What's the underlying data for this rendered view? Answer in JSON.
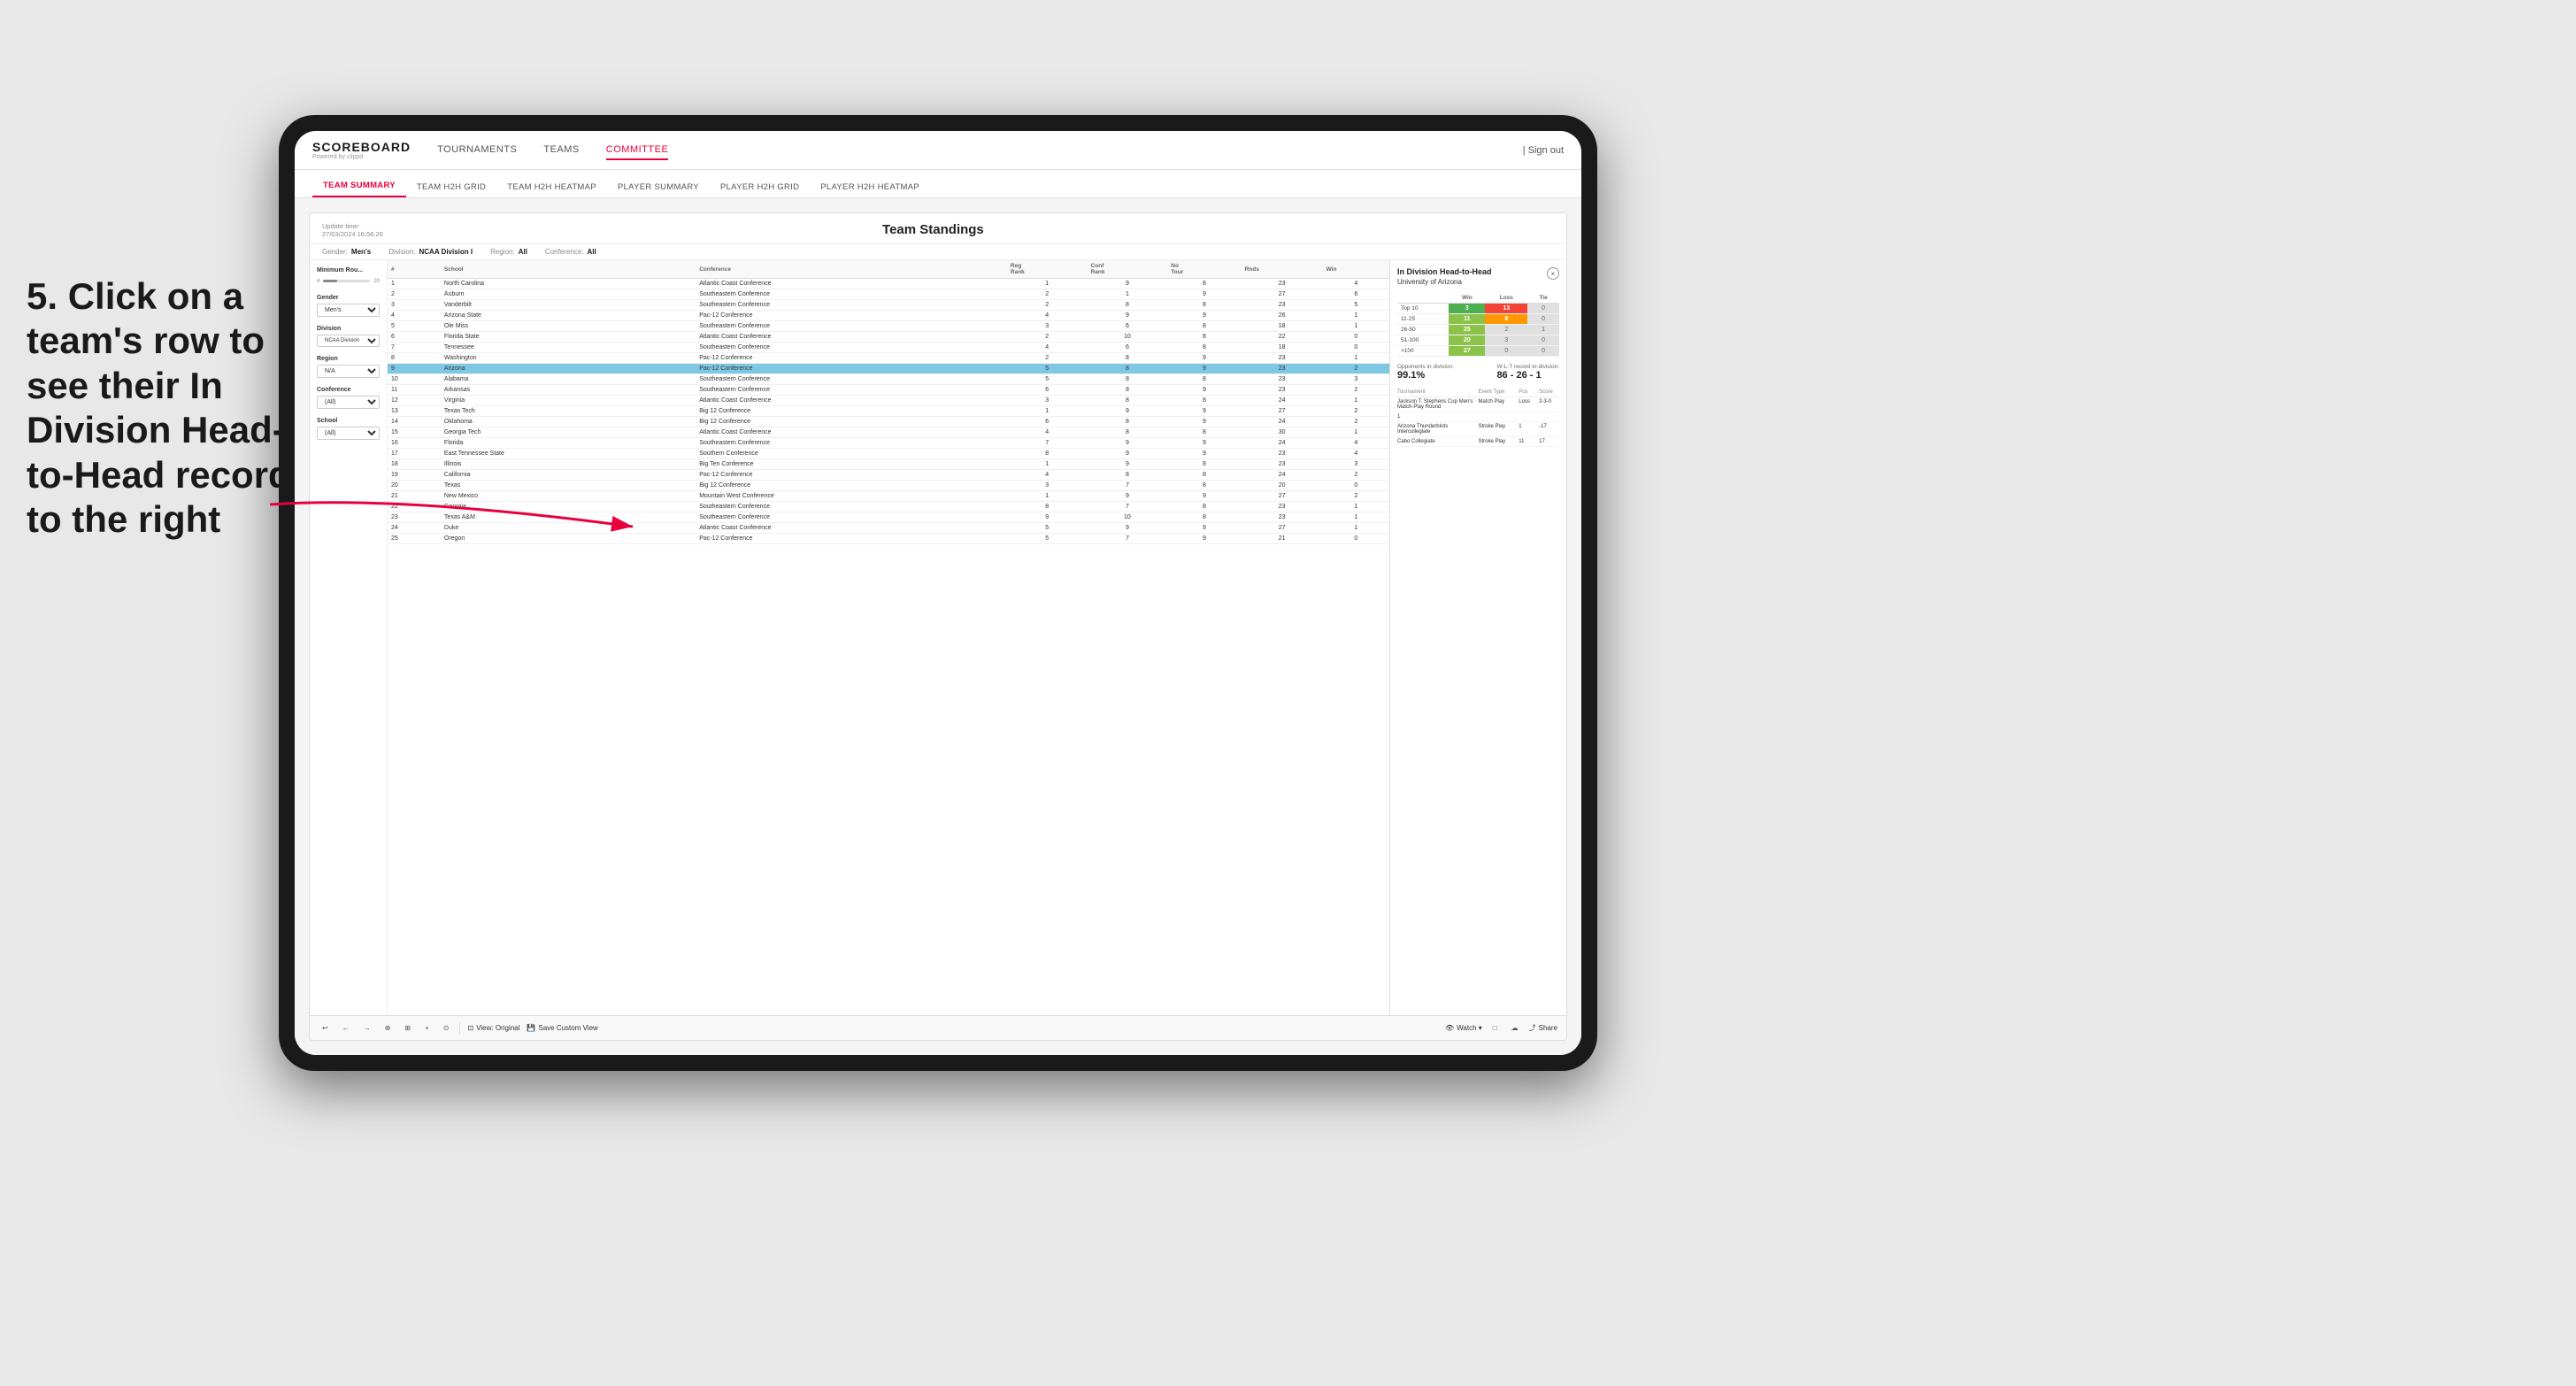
{
  "background_color": "#e8e8e8",
  "annotation": {
    "text": "5. Click on a team's row to see their In Division Head-to-Head record to the right"
  },
  "top_nav": {
    "logo": "SCOREBOARD",
    "logo_sub": "Powered by clippd",
    "items": [
      "TOURNAMENTS",
      "TEAMS",
      "COMMITTEE"
    ],
    "active_item": "COMMITTEE",
    "sign_out": "Sign out"
  },
  "secondary_nav": {
    "items": [
      "TEAM SUMMARY",
      "TEAM H2H GRID",
      "TEAM H2H HEATMAP",
      "PLAYER SUMMARY",
      "PLAYER H2H GRID",
      "PLAYER H2H HEATMAP"
    ],
    "active_item": "TEAM SUMMARY"
  },
  "panel": {
    "update_time_label": "Update time:",
    "update_time_value": "27/03/2024 16:56:26",
    "title": "Team Standings"
  },
  "filters": {
    "gender_label": "Gender:",
    "gender_value": "Men's",
    "division_label": "Division:",
    "division_value": "NCAA Division I",
    "region_label": "Region:",
    "region_value": "All",
    "conference_label": "Conference:",
    "conference_value": "All"
  },
  "sidebar_filters": {
    "min_rounds_label": "Minimum Rou...",
    "min_rounds_min": "4",
    "min_rounds_max": "20",
    "gender_label": "Gender",
    "gender_value": "Men's",
    "division_label": "Division",
    "division_value": "NCAA Division I",
    "region_label": "Region",
    "region_value": "N/A",
    "conference_label": "Conference",
    "conference_value": "(All)",
    "school_label": "School",
    "school_value": "(All)"
  },
  "table": {
    "headers": [
      "#",
      "School",
      "Conference",
      "Reg Rank",
      "Conf Rank",
      "No Tour",
      "Rnds",
      "Win"
    ],
    "rows": [
      {
        "rank": 1,
        "school": "North Carolina",
        "conference": "Atlantic Coast Conference",
        "reg_rank": 1,
        "conf_rank": 9,
        "no_tour": 8,
        "rnds": 23,
        "win": 4
      },
      {
        "rank": 2,
        "school": "Auburn",
        "conference": "Southeastern Conference",
        "reg_rank": 2,
        "conf_rank": 1,
        "no_tour": 9,
        "rnds": 27,
        "win": 6
      },
      {
        "rank": 3,
        "school": "Vanderbilt",
        "conference": "Southeastern Conference",
        "reg_rank": 2,
        "conf_rank": 8,
        "no_tour": 8,
        "rnds": 23,
        "win": 5
      },
      {
        "rank": 4,
        "school": "Arizona State",
        "conference": "Pac-12 Conference",
        "reg_rank": 4,
        "conf_rank": 9,
        "no_tour": 9,
        "rnds": 26,
        "win": 1
      },
      {
        "rank": 5,
        "school": "Ole Miss",
        "conference": "Southeastern Conference",
        "reg_rank": 3,
        "conf_rank": 6,
        "no_tour": 8,
        "rnds": 18,
        "win": 1
      },
      {
        "rank": 6,
        "school": "Florida State",
        "conference": "Atlantic Coast Conference",
        "reg_rank": 2,
        "conf_rank": 10,
        "no_tour": 8,
        "rnds": 22,
        "win": 0
      },
      {
        "rank": 7,
        "school": "Tennessee",
        "conference": "Southeastern Conference",
        "reg_rank": 4,
        "conf_rank": 6,
        "no_tour": 8,
        "rnds": 18,
        "win": 0
      },
      {
        "rank": 8,
        "school": "Washington",
        "conference": "Pac-12 Conference",
        "reg_rank": 2,
        "conf_rank": 8,
        "no_tour": 9,
        "rnds": 23,
        "win": 1
      },
      {
        "rank": 9,
        "school": "Arizona",
        "conference": "Pac-12 Conference",
        "reg_rank": 5,
        "conf_rank": 8,
        "no_tour": 9,
        "rnds": 23,
        "win": 2,
        "highlighted": true
      },
      {
        "rank": 10,
        "school": "Alabama",
        "conference": "Southeastern Conference",
        "reg_rank": 5,
        "conf_rank": 8,
        "no_tour": 8,
        "rnds": 23,
        "win": 3
      },
      {
        "rank": 11,
        "school": "Arkansas",
        "conference": "Southeastern Conference",
        "reg_rank": 6,
        "conf_rank": 8,
        "no_tour": 9,
        "rnds": 23,
        "win": 2
      },
      {
        "rank": 12,
        "school": "Virginia",
        "conference": "Atlantic Coast Conference",
        "reg_rank": 3,
        "conf_rank": 8,
        "no_tour": 8,
        "rnds": 24,
        "win": 1
      },
      {
        "rank": 13,
        "school": "Texas Tech",
        "conference": "Big 12 Conference",
        "reg_rank": 1,
        "conf_rank": 9,
        "no_tour": 9,
        "rnds": 27,
        "win": 2
      },
      {
        "rank": 14,
        "school": "Oklahoma",
        "conference": "Big 12 Conference",
        "reg_rank": 6,
        "conf_rank": 8,
        "no_tour": 9,
        "rnds": 24,
        "win": 2
      },
      {
        "rank": 15,
        "school": "Georgia Tech",
        "conference": "Atlantic Coast Conference",
        "reg_rank": 4,
        "conf_rank": 8,
        "no_tour": 8,
        "rnds": 30,
        "win": 1
      },
      {
        "rank": 16,
        "school": "Florida",
        "conference": "Southeastern Conference",
        "reg_rank": 7,
        "conf_rank": 9,
        "no_tour": 9,
        "rnds": 24,
        "win": 4
      },
      {
        "rank": 17,
        "school": "East Tennessee State",
        "conference": "Southern Conference",
        "reg_rank": 8,
        "conf_rank": 9,
        "no_tour": 9,
        "rnds": 23,
        "win": 4
      },
      {
        "rank": 18,
        "school": "Illinois",
        "conference": "Big Ten Conference",
        "reg_rank": 1,
        "conf_rank": 9,
        "no_tour": 8,
        "rnds": 23,
        "win": 3
      },
      {
        "rank": 19,
        "school": "California",
        "conference": "Pac-12 Conference",
        "reg_rank": 4,
        "conf_rank": 8,
        "no_tour": 8,
        "rnds": 24,
        "win": 2
      },
      {
        "rank": 20,
        "school": "Texas",
        "conference": "Big 12 Conference",
        "reg_rank": 3,
        "conf_rank": 7,
        "no_tour": 8,
        "rnds": 20,
        "win": 0
      },
      {
        "rank": 21,
        "school": "New Mexico",
        "conference": "Mountain West Conference",
        "reg_rank": 1,
        "conf_rank": 9,
        "no_tour": 9,
        "rnds": 27,
        "win": 2
      },
      {
        "rank": 22,
        "school": "Georgia",
        "conference": "Southeastern Conference",
        "reg_rank": 8,
        "conf_rank": 7,
        "no_tour": 8,
        "rnds": 23,
        "win": 1
      },
      {
        "rank": 23,
        "school": "Texas A&M",
        "conference": "Southeastern Conference",
        "reg_rank": 9,
        "conf_rank": 10,
        "no_tour": 8,
        "rnds": 23,
        "win": 1
      },
      {
        "rank": 24,
        "school": "Duke",
        "conference": "Atlantic Coast Conference",
        "reg_rank": 5,
        "conf_rank": 9,
        "no_tour": 9,
        "rnds": 27,
        "win": 1
      },
      {
        "rank": 25,
        "school": "Oregon",
        "conference": "Pac-12 Conference",
        "reg_rank": 5,
        "conf_rank": 7,
        "no_tour": 9,
        "rnds": 21,
        "win": 0
      }
    ]
  },
  "h2h_panel": {
    "title": "In Division Head-to-Head",
    "subtitle": "University of Arizona",
    "close_label": "×",
    "table_headers": [
      "",
      "Win",
      "Loss",
      "Tie"
    ],
    "rows": [
      {
        "label": "Top 10",
        "win": 3,
        "loss": 13,
        "tie": 0,
        "win_color": "green",
        "loss_color": "red",
        "tie_color": "gray"
      },
      {
        "label": "11-25",
        "win": 11,
        "loss": 8,
        "tie": 0,
        "win_color": "light-green",
        "loss_color": "orange",
        "tie_color": "gray"
      },
      {
        "label": "26-50",
        "win": 25,
        "loss": 2,
        "tie": 1,
        "win_color": "light-green",
        "loss_color": "gray",
        "tie_color": "gray"
      },
      {
        "label": "51-100",
        "win": 20,
        "loss": 3,
        "tie": 0,
        "win_color": "light-green",
        "loss_color": "gray",
        "tie_color": "gray"
      },
      {
        "label": ">100",
        "win": 27,
        "loss": 0,
        "tie": 0,
        "win_color": "light-green",
        "loss_color": "gray",
        "tie_color": "gray"
      }
    ],
    "opponents_label": "Opponents in division:",
    "opponents_value": "99.1%",
    "record_label": "W-L-T record in-division:",
    "record_value": "86 - 26 - 1",
    "tournament_headers": [
      "Tournament",
      "Event Type",
      "Pos",
      "Score"
    ],
    "tournaments": [
      {
        "name": "Jackson T. Stephens Cup Men's Match-Play Round",
        "type": "Match Play",
        "pos": "Loss",
        "score": "2-3-0"
      },
      {
        "name": "1",
        "type": "",
        "pos": "",
        "score": ""
      },
      {
        "name": "Arizona Thunderbirds Intercollegiate",
        "type": "Stroke Play",
        "pos": "1",
        "score": "-17"
      },
      {
        "name": "Cabo Collegiate",
        "type": "Stroke Play",
        "pos": "11",
        "score": "17"
      }
    ]
  },
  "toolbar": {
    "buttons": [
      "↩",
      "←",
      "→",
      "⊕",
      "⊞",
      "+",
      "⊙",
      "View: Original",
      "Save Custom View",
      "Watch",
      "□",
      "☁",
      "Share"
    ]
  }
}
